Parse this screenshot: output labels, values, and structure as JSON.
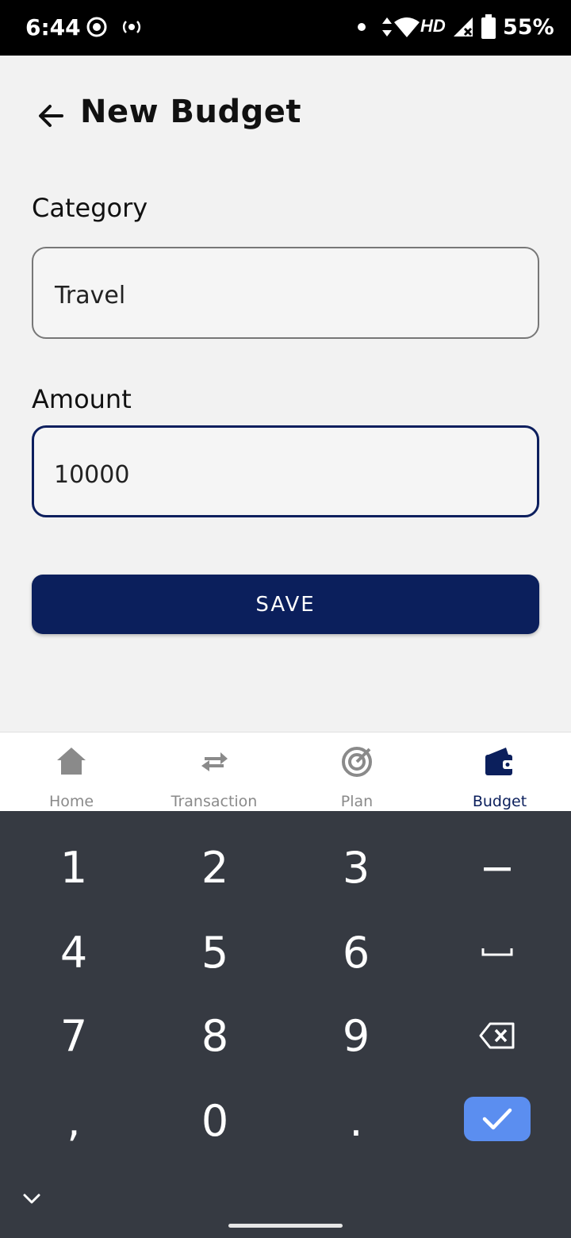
{
  "status_bar": {
    "time": "6:44",
    "network_label": "HD",
    "battery": "55%"
  },
  "header": {
    "title": "New Budget"
  },
  "form": {
    "category_label": "Category",
    "category_value": "Travel",
    "amount_label": "Amount",
    "amount_value": "10000",
    "save_label": "SAVE"
  },
  "bottom_nav": {
    "items": [
      {
        "label": "Home",
        "icon": "home-icon",
        "active": false
      },
      {
        "label": "Transaction",
        "icon": "swap-arrows-icon",
        "active": false
      },
      {
        "label": "Plan",
        "icon": "target-icon",
        "active": false
      },
      {
        "label": "Budget",
        "icon": "wallet-icon",
        "active": true
      }
    ]
  },
  "keyboard": {
    "keys": [
      "1",
      "2",
      "3",
      "−",
      "4",
      "5",
      "6",
      "␣",
      "7",
      "8",
      "9",
      "⌫",
      ",",
      "0",
      ".",
      "✓"
    ]
  },
  "colors": {
    "primary": "#0b1f5c",
    "keyboard_bg": "#363a42",
    "done_key": "#5b8ef0",
    "inactive_nav": "#8a8a8a"
  }
}
